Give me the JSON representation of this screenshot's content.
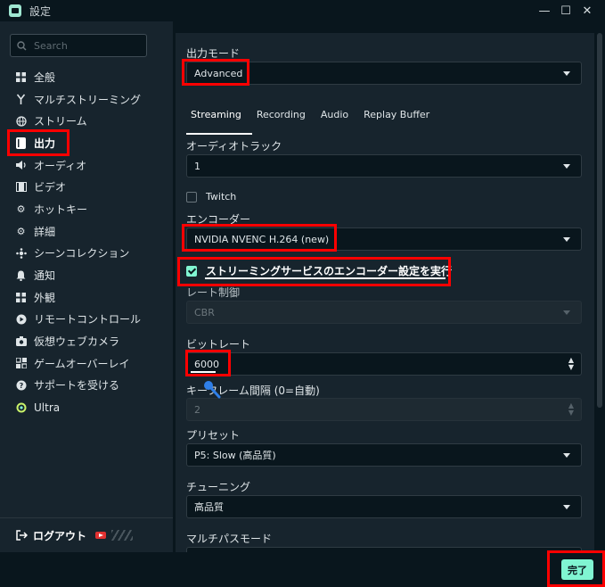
{
  "window": {
    "title": "設定",
    "minimize": "—",
    "maximize": "☐",
    "close": "✕"
  },
  "sidebar": {
    "search_placeholder": "Search",
    "items": [
      {
        "label": "全般",
        "icon": "grid-icon"
      },
      {
        "label": "マルチストリーミング",
        "icon": "split-icon"
      },
      {
        "label": "ストリーム",
        "icon": "globe-icon"
      },
      {
        "label": "出力",
        "icon": "output-icon"
      },
      {
        "label": "オーディオ",
        "icon": "speaker-icon"
      },
      {
        "label": "ビデオ",
        "icon": "film-icon"
      },
      {
        "label": "ホットキー",
        "icon": "gear-icon"
      },
      {
        "label": "詳細",
        "icon": "gears-icon"
      },
      {
        "label": "シーンコレクション",
        "icon": "collection-icon"
      },
      {
        "label": "通知",
        "icon": "bell-icon"
      },
      {
        "label": "外観",
        "icon": "appearance-icon"
      },
      {
        "label": "リモートコントロール",
        "icon": "remote-icon"
      },
      {
        "label": "仮想ウェブカメラ",
        "icon": "camera-icon"
      },
      {
        "label": "ゲームオーバーレイ",
        "icon": "overlay-icon"
      },
      {
        "label": "サポートを受ける",
        "icon": "help-icon"
      },
      {
        "label": "Ultra",
        "icon": "ultra-icon"
      }
    ],
    "active_index": 3,
    "logout_label": "ログアウト"
  },
  "main": {
    "output_mode": {
      "label": "出力モード",
      "value": "Advanced"
    },
    "tabs": [
      "Streaming",
      "Recording",
      "Audio",
      "Replay Buffer"
    ],
    "audio_track": {
      "label": "オーディオトラック",
      "value": "1"
    },
    "twitch_label": "Twitch",
    "encoder": {
      "label": "エンコーダー",
      "value": "NVIDIA NVENC H.264 (new)"
    },
    "enforce_label": "ストリーミングサービスのエンコーダー設定を実行",
    "rate_control": {
      "label": "レート制御",
      "value": "CBR"
    },
    "bitrate": {
      "label": "ビットレート",
      "value": "6000"
    },
    "keyframe": {
      "label": "キーフレーム間隔 (0=自動)",
      "value": "2"
    },
    "preset": {
      "label": "プリセット",
      "value": "P5: Slow (高品質)"
    },
    "tuning": {
      "label": "チューニング",
      "value": "高品質"
    },
    "multipass": {
      "label": "マルチパスモード"
    }
  },
  "footer": {
    "done_label": "完了"
  },
  "colors": {
    "accent": "#80f5d2",
    "highlight": "#ff0000",
    "panel": "#17242d",
    "background": "#09161d"
  }
}
